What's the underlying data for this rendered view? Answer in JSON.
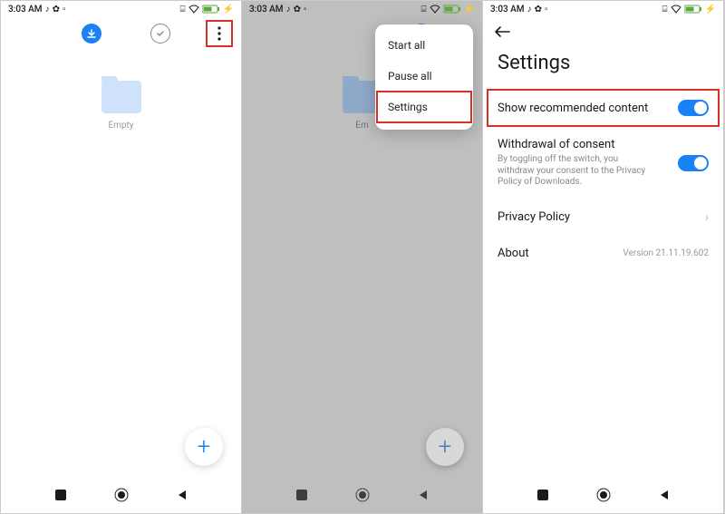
{
  "status": {
    "time": "3:03 AM",
    "left_icons": [
      "tiktok",
      "gear",
      "placeholder"
    ],
    "right_icons": [
      "cast",
      "wifi",
      "battery",
      "bolt"
    ]
  },
  "pane1": {
    "empty_label": "Empty"
  },
  "pane2": {
    "empty_label_partial": "Em",
    "menu": {
      "start_all": "Start all",
      "pause_all": "Pause all",
      "settings": "Settings"
    }
  },
  "pane3": {
    "title": "Settings",
    "items": {
      "show_recommended": {
        "label": "Show recommended content"
      },
      "withdrawal": {
        "label": "Withdrawal of consent",
        "sub": "By toggling off the switch, you withdraw your consent to the Privacy Policy of Downloads."
      },
      "privacy": {
        "label": "Privacy Policy"
      },
      "about": {
        "label": "About",
        "version": "Version 21.11.19.602"
      }
    }
  }
}
